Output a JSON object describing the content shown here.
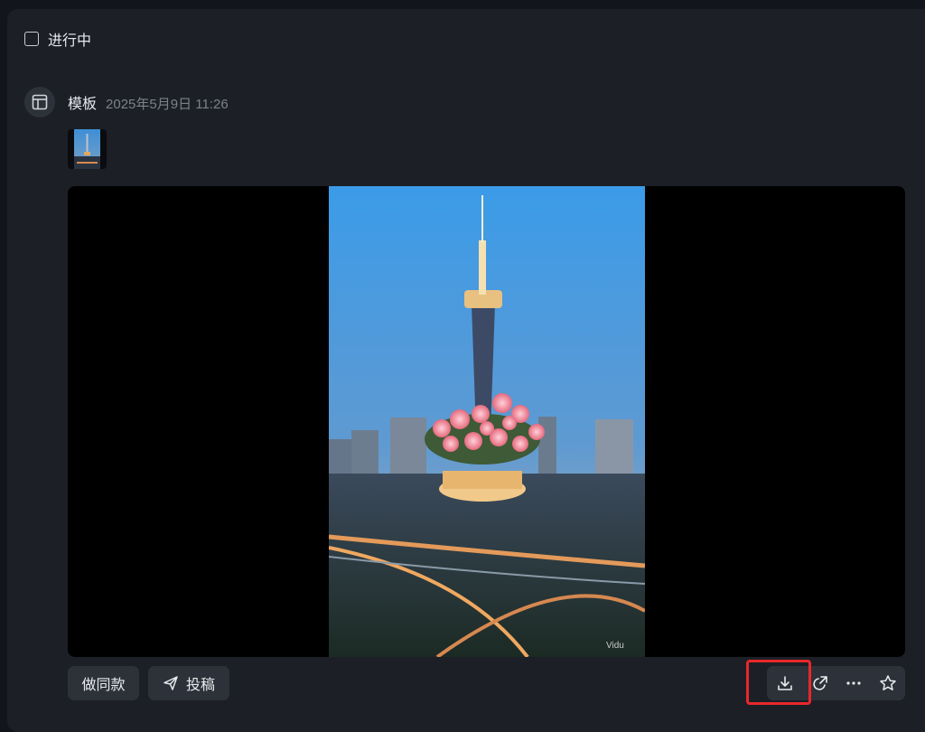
{
  "task": {
    "status_label": "进行中"
  },
  "post": {
    "title": "模板",
    "timestamp": "2025年5月9日 11:26",
    "avatar_icon": "layout-template-icon",
    "video_watermark": "Vidu"
  },
  "actions": {
    "make_same_label": "做同款",
    "submit_label": "投稿",
    "submit_icon": "send-icon",
    "download_icon": "download-icon",
    "share_icon": "share-icon",
    "more_icon": "more-icon",
    "favorite_icon": "star-icon"
  },
  "colors": {
    "highlight": "#e8282b",
    "panel": "#1c1f26",
    "button": "#2d3139"
  }
}
